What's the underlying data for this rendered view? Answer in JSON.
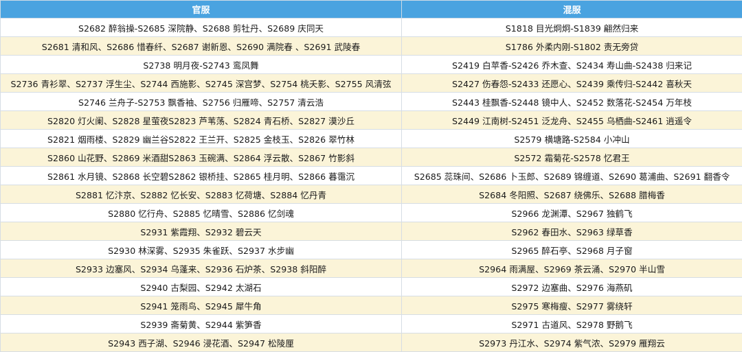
{
  "headers": {
    "col1": "官服",
    "col2": "混服"
  },
  "rows": [
    [
      "S2682 醉翁操-S2685 深院静、S2688 剪牡丹、S2689 庆同天",
      "S1818 目光炯炯-S1839 翩然归来"
    ],
    [
      "S2681 清和风、S2686 惜春纤、S2687 谢新恩、S2690 满院春 、S2691 武陵春",
      "S1786 外柔内刚-S1802 责无旁贷"
    ],
    [
      "S2738 明月夜-S2743 鸾凤舞",
      "S2419 白苹香-S2426 乔木查、S2434 寿山曲-S2438 归来记"
    ],
    [
      "S2736 青衫翠、S2737 浮生尘、S2744 西施影、S2745 深宫梦、S2754 桃夭影、S2755 风清弦",
      "S2427 伤春怨-S2433 还愿心、S2439 乘传归-S2442 喜秋天"
    ],
    [
      "S2746 兰舟子-S2753 飘香袖、S2756 归雁啼、S2757 清云浩",
      "S2443 桂飘香-S2448 镜中人、S2452 数落花-S2454 万年枝"
    ],
    [
      "S2820 灯火阑、S2828 星萤夜S2823 芦苇荡、S2824 青石桥、S2827 漠沙丘",
      "S2449 江南树-S2451 泛龙舟、S2455 乌栖曲-S2461 逍遥令"
    ],
    [
      "S2821 烟雨楼、S2829 幽兰谷S2822 王兰开、S2825 金枝玉、S2826 翠竹林",
      "S2579 横塘路-S2584 小冲山"
    ],
    [
      "S2860 山花野、S2869 米酒甜S2863 玉碗满、S2864 浮云散、S2867 竹影斜",
      "S2572 霜菊花-S2578 忆君王"
    ],
    [
      "S2861 水月镜、S2868 长空碧S2862 银桥挂、S2865 桂月明、S2866 暮霭沉",
      "S2685 蕊珠间、S2686 卜玉郎、S2689 锦缠道、S2690 葛浦曲、S2691 翻香令"
    ],
    [
      "S2881 忆汴京、S2882 忆长安、S2883 忆荷塘、S2884 忆丹青",
      "S2684 冬阳照、S2687 绕佛乐、S2688 腊梅香"
    ],
    [
      "S2880 忆行舟、S2885 忆晴雪、S2886 忆剑魂",
      "S2966 龙渊潭、S2967 独鹤飞"
    ],
    [
      "S2931 紫霞翔、S2932 碧云天",
      "S2962 春田水、S2963 绿草香"
    ],
    [
      "S2930 林深雾、S2935 朱雀跃、S2937 水步幽",
      "S2965 醉石亭、S2968 月子窗"
    ],
    [
      "S2933 边塞风、S2934 乌蓬来、S2936 石炉茶、S2938 斜阳醉",
      "S2964 雨满屋、S2969 茶云涌、S2970 半山雪"
    ],
    [
      "S2940 古梨园、S2942 太湖石",
      "S2972 边塞曲、S2976 海燕矶"
    ],
    [
      "S2941 笼雨鸟、S2945 犀牛角",
      "S2975 寒梅瘦、S2977 雾绕轩"
    ],
    [
      "S2939 斋菊黄、S2944 紫笋香",
      "S2971 古道风、S2978 野鹅飞"
    ],
    [
      "S2943 西子湖、S2946 浸花酒、S2947 松陵厘",
      "S2973 丹江水、S2974 紫气浓、S2979 雁翔云"
    ]
  ]
}
